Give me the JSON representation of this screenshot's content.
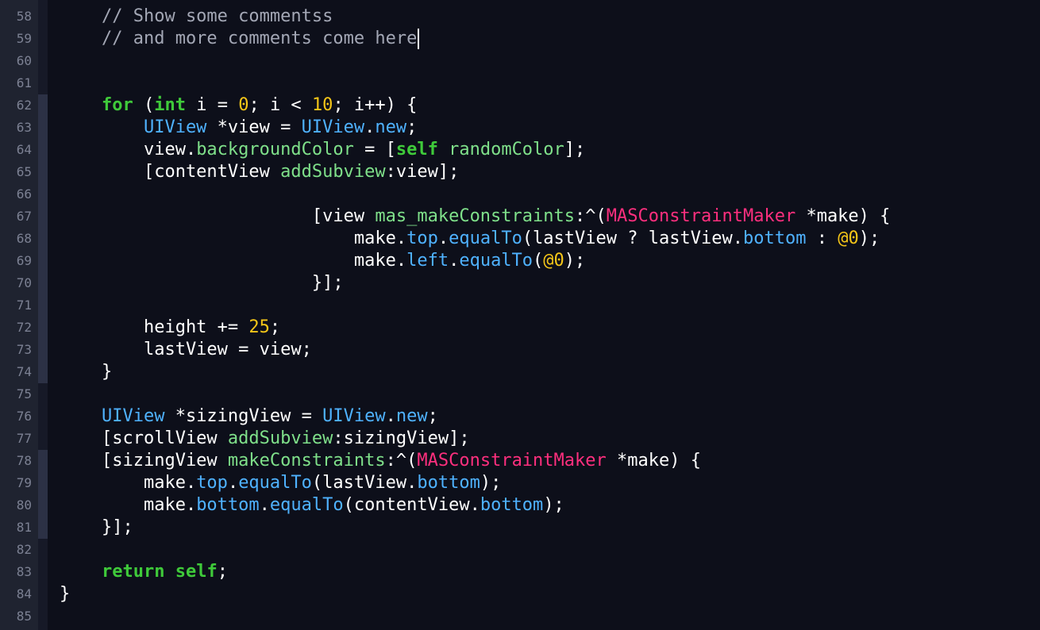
{
  "editor": {
    "theme_colors": {
      "background": "#0d0f1a",
      "gutter": "#1f2330",
      "line_number": "#7c8193",
      "comment": "#a3a7b5",
      "keyword": "#3fca3a",
      "number": "#f5c618",
      "type": "#4fb2ff",
      "method": "#7fe08a",
      "class": "#ff2f7e"
    },
    "line_numbers": [
      "58",
      "59",
      "60",
      "61",
      "62",
      "63",
      "64",
      "65",
      "66",
      "67",
      "68",
      "69",
      "70",
      "71",
      "72",
      "73",
      "74",
      "75",
      "76",
      "77",
      "78",
      "79",
      "80",
      "81",
      "82",
      "83",
      "84",
      "85"
    ],
    "lines": [
      [
        [
          "t-comment",
          "    // Show some commentss"
        ]
      ],
      [
        [
          "t-comment",
          "    // and more comments come here"
        ]
      ],
      [],
      [],
      [
        [
          "t-keyword",
          "    for"
        ],
        [
          "t-plain",
          " ("
        ],
        [
          "t-keyword",
          "int"
        ],
        [
          "t-plain",
          " i = "
        ],
        [
          "t-number",
          "0"
        ],
        [
          "t-plain",
          "; i < "
        ],
        [
          "t-number",
          "10"
        ],
        [
          "t-plain",
          "; i++) {"
        ]
      ],
      [
        [
          "t-type",
          "        UIView"
        ],
        [
          "t-plain",
          " *view = "
        ],
        [
          "t-type",
          "UIView"
        ],
        [
          "t-plain",
          "."
        ],
        [
          "t-property",
          "new"
        ],
        [
          "t-plain",
          ";"
        ]
      ],
      [
        [
          "t-plain",
          "        view."
        ],
        [
          "t-method",
          "backgroundColor"
        ],
        [
          "t-plain",
          " = ["
        ],
        [
          "t-keyword",
          "self"
        ],
        [
          "t-plain",
          " "
        ],
        [
          "t-method",
          "randomColor"
        ],
        [
          "t-plain",
          "];"
        ]
      ],
      [
        [
          "t-plain",
          "        [contentView "
        ],
        [
          "t-method",
          "addSubview"
        ],
        [
          "t-plain",
          ":view];"
        ]
      ],
      [],
      [
        [
          "t-plain",
          "                        [view "
        ],
        [
          "t-method",
          "mas_makeConstraints"
        ],
        [
          "t-plain",
          ":^("
        ],
        [
          "t-class",
          "MASConstraintMaker"
        ],
        [
          "t-plain",
          " *make) {"
        ]
      ],
      [
        [
          "t-plain",
          "                            make."
        ],
        [
          "t-property",
          "top"
        ],
        [
          "t-plain",
          "."
        ],
        [
          "t-property",
          "equalTo"
        ],
        [
          "t-plain",
          "(lastView ? lastView."
        ],
        [
          "t-property",
          "bottom"
        ],
        [
          "t-plain",
          " : "
        ],
        [
          "t-literal",
          "@0"
        ],
        [
          "t-plain",
          ");"
        ]
      ],
      [
        [
          "t-plain",
          "                            make."
        ],
        [
          "t-property",
          "left"
        ],
        [
          "t-plain",
          "."
        ],
        [
          "t-property",
          "equalTo"
        ],
        [
          "t-plain",
          "("
        ],
        [
          "t-literal",
          "@0"
        ],
        [
          "t-plain",
          ");"
        ]
      ],
      [
        [
          "t-plain",
          "                        }];"
        ]
      ],
      [],
      [
        [
          "t-plain",
          "        height += "
        ],
        [
          "t-number",
          "25"
        ],
        [
          "t-plain",
          ";"
        ]
      ],
      [
        [
          "t-plain",
          "        lastView = view;"
        ]
      ],
      [
        [
          "t-plain",
          "    }"
        ]
      ],
      [],
      [
        [
          "t-type",
          "    UIView"
        ],
        [
          "t-plain",
          " *sizingView = "
        ],
        [
          "t-type",
          "UIView"
        ],
        [
          "t-plain",
          "."
        ],
        [
          "t-property",
          "new"
        ],
        [
          "t-plain",
          ";"
        ]
      ],
      [
        [
          "t-plain",
          "    [scrollView "
        ],
        [
          "t-method",
          "addSubview"
        ],
        [
          "t-plain",
          ":sizingView];"
        ]
      ],
      [
        [
          "t-plain",
          "    [sizingView "
        ],
        [
          "t-method",
          "makeConstraints"
        ],
        [
          "t-plain",
          ":^("
        ],
        [
          "t-class",
          "MASConstraintMaker"
        ],
        [
          "t-plain",
          " *make) {"
        ]
      ],
      [
        [
          "t-plain",
          "        make."
        ],
        [
          "t-property",
          "top"
        ],
        [
          "t-plain",
          "."
        ],
        [
          "t-property",
          "equalTo"
        ],
        [
          "t-plain",
          "(lastView."
        ],
        [
          "t-property",
          "bottom"
        ],
        [
          "t-plain",
          ");"
        ]
      ],
      [
        [
          "t-plain",
          "        make."
        ],
        [
          "t-property",
          "bottom"
        ],
        [
          "t-plain",
          "."
        ],
        [
          "t-property",
          "equalTo"
        ],
        [
          "t-plain",
          "(contentView."
        ],
        [
          "t-property",
          "bottom"
        ],
        [
          "t-plain",
          ");"
        ]
      ],
      [
        [
          "t-plain",
          "    }];"
        ]
      ],
      [],
      [
        [
          "t-keyword",
          "    return"
        ],
        [
          "t-plain",
          " "
        ],
        [
          "t-keyword",
          "self"
        ],
        [
          "t-plain",
          ";"
        ]
      ],
      [
        [
          "t-plain",
          "}"
        ]
      ],
      []
    ]
  }
}
